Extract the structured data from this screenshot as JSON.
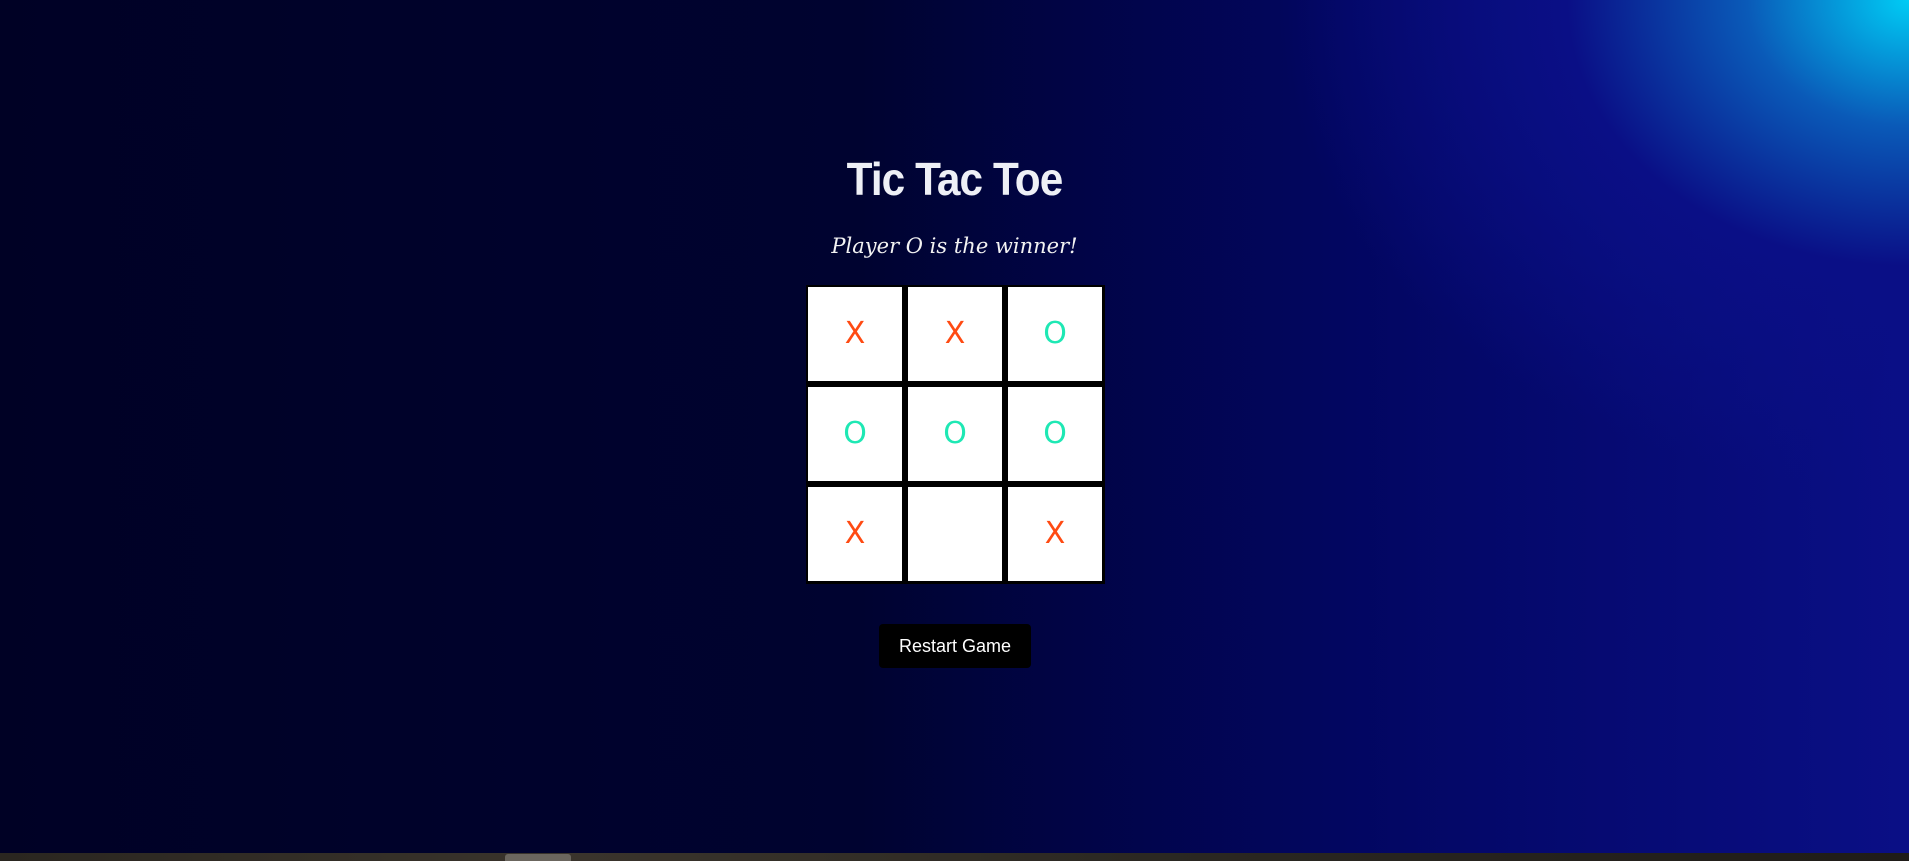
{
  "game": {
    "title": "Tic Tac Toe",
    "status": "Player O is the winner!",
    "restart_label": "Restart Game",
    "colors": {
      "x": "#ff4a12",
      "o": "#1ee8b4"
    },
    "board": [
      [
        "X",
        "X",
        "O"
      ],
      [
        "O",
        "O",
        "O"
      ],
      [
        "X",
        "",
        "X"
      ]
    ]
  }
}
